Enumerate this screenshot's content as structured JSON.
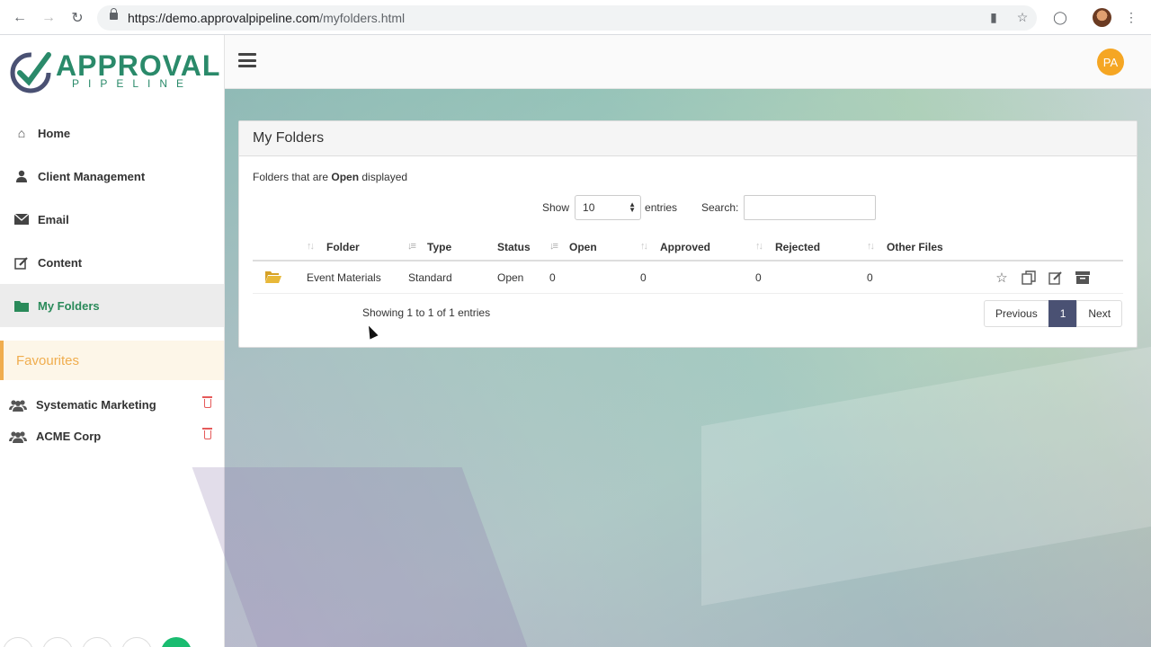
{
  "browser": {
    "url_host": "https://demo.approvalpipeline.com",
    "url_path": "/myfolders.html"
  },
  "logo": {
    "title": "APPROVAL",
    "subtitle": "PIPELINE"
  },
  "sidebar": {
    "items": [
      {
        "label": "Home",
        "icon": "home-icon"
      },
      {
        "label": "Client Management",
        "icon": "user-icon"
      },
      {
        "label": "Email",
        "icon": "envelope-icon"
      },
      {
        "label": "Content",
        "icon": "edit-icon"
      },
      {
        "label": "My Folders",
        "icon": "folder-icon",
        "active": true
      }
    ],
    "favourites_title": "Favourites",
    "favourites": [
      {
        "label": "Systematic Marketing",
        "icon": "users-icon"
      },
      {
        "label": "ACME Corp",
        "icon": "users-icon"
      }
    ]
  },
  "topbar": {
    "user_initials": "PA",
    "avatar_color": "#f5a623"
  },
  "panel": {
    "title": "My Folders",
    "note_prefix": "Folders that are ",
    "note_status": "Open",
    "note_suffix": " displayed",
    "show_label": "Show",
    "entries_value": "10",
    "entries_label": "entries",
    "search_label": "Search:",
    "search_value": ""
  },
  "table": {
    "columns": [
      "Folder",
      "Type",
      "Status",
      "Open",
      "Approved",
      "Rejected",
      "Other Files"
    ],
    "rows": [
      {
        "folder": "Event Materials",
        "type": "Standard",
        "status": "Open",
        "open": "0",
        "approved": "0",
        "rejected": "0",
        "other_files": "0"
      }
    ],
    "info": "Showing 1 to 1 of 1 entries"
  },
  "pagination": {
    "previous": "Previous",
    "current": "1",
    "next": "Next"
  },
  "colors": {
    "brand": "#2a8a6a",
    "favourites_accent": "#f0ad4e",
    "pager_active": "#4a5173"
  }
}
